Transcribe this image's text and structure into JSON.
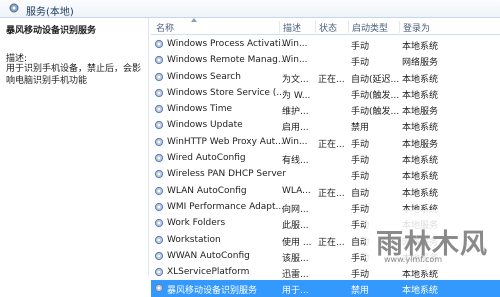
{
  "header": {
    "title": "服务(本地)"
  },
  "left_pane": {
    "service_title": "暴风移动设备识别服务",
    "desc_label": "描述:",
    "desc_text": "用于识别手机设备，禁止后，会影响电脑识别手机功能"
  },
  "columns": {
    "name": "名称",
    "description": "描述",
    "status": "状态",
    "startup": "启动类型",
    "logon": "登录为"
  },
  "rows": [
    {
      "name": "Windows Process Activati...",
      "desc": "Win...",
      "status": "",
      "startup": "手动",
      "logon": "本地系统"
    },
    {
      "name": "Windows Remote Manag...",
      "desc": "Win...",
      "status": "",
      "startup": "手动",
      "logon": "网络服务"
    },
    {
      "name": "Windows Search",
      "desc": "为文...",
      "status": "正在...",
      "startup": "自动(延迟...",
      "logon": "本地系统"
    },
    {
      "name": "Windows Store Service (...",
      "desc": "为 W...",
      "status": "",
      "startup": "手动(触发...",
      "logon": "本地系统"
    },
    {
      "name": "Windows Time",
      "desc": "维护...",
      "status": "",
      "startup": "手动(触发...",
      "logon": "本地服务"
    },
    {
      "name": "Windows Update",
      "desc": "启用...",
      "status": "",
      "startup": "禁用",
      "logon": "本地系统"
    },
    {
      "name": "WinHTTP Web Proxy Aut...",
      "desc": "Win...",
      "status": "正在...",
      "startup": "手动",
      "logon": "本地服务"
    },
    {
      "name": "Wired AutoConfig",
      "desc": "有线...",
      "status": "",
      "startup": "手动",
      "logon": "本地系统"
    },
    {
      "name": "Wireless PAN DHCP Server",
      "desc": "",
      "status": "",
      "startup": "手动",
      "logon": "本地系统"
    },
    {
      "name": "WLAN AutoConfig",
      "desc": "WLA...",
      "status": "正在...",
      "startup": "自动",
      "logon": "本地系统"
    },
    {
      "name": "WMI Performance Adapt...",
      "desc": "向网...",
      "status": "",
      "startup": "手动",
      "logon": "本地系统"
    },
    {
      "name": "Work Folders",
      "desc": "此服...",
      "status": "",
      "startup": "手动",
      "logon": "本地服务"
    },
    {
      "name": "Workstation",
      "desc": "使用 ...",
      "status": "正在...",
      "startup": "自动",
      "logon": "网络服务"
    },
    {
      "name": "WWAN AutoConfig",
      "desc": "该服...",
      "status": "",
      "startup": "手动",
      "logon": "本地服务"
    },
    {
      "name": "XLServicePlatform",
      "desc": "迅雷...",
      "status": "",
      "startup": "手动",
      "logon": "本地系统"
    },
    {
      "name": "暴风移动设备识别服务",
      "desc": "用于...",
      "status": "",
      "startup": "禁用",
      "logon": "本地系统"
    }
  ],
  "selected_index": 15,
  "watermark": {
    "text": "雨林木风",
    "sub": "www.ylmf.com"
  },
  "colors": {
    "selection": "#3399ff",
    "header_text": "#4c607a",
    "icon": "#5a7fb0"
  }
}
